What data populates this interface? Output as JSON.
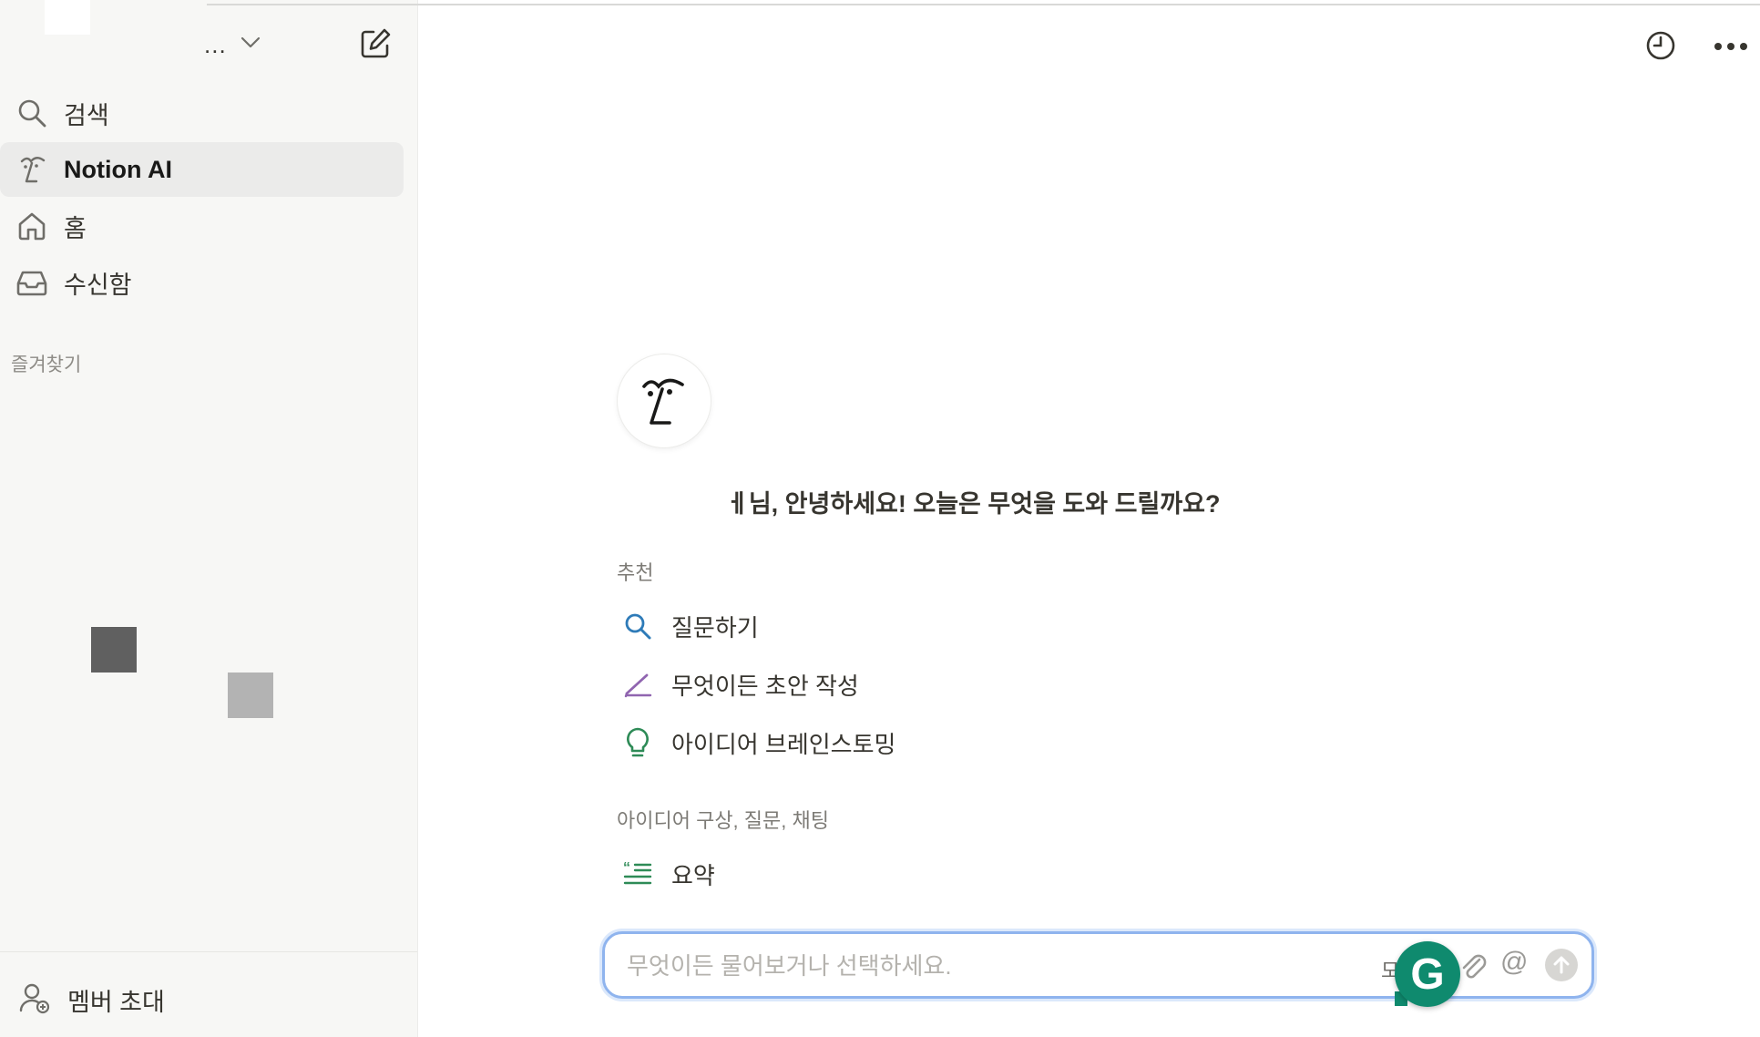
{
  "sidebar": {
    "workspace_name": "...",
    "nav": [
      {
        "label": "검색",
        "icon": "search-icon"
      },
      {
        "label": "Notion AI",
        "icon": "notion-ai-face-icon",
        "active": true
      },
      {
        "label": "홈",
        "icon": "home-icon"
      },
      {
        "label": "수신함",
        "icon": "inbox-icon"
      }
    ],
    "favorites_title": "즐겨찾기",
    "invite_label": "멤버 초대"
  },
  "main": {
    "greeting": "ㅔ님, 안녕하세요! 오늘은 무엇을 도와 드릴까요?",
    "recommended_title": "추천",
    "recommended": [
      {
        "label": "질문하기",
        "icon": "search-icon",
        "color": "#2e7bb8"
      },
      {
        "label": "무엇이든 초안 작성",
        "icon": "pencil-icon",
        "color": "#9065b0"
      },
      {
        "label": "아이디어 브레인스토밍",
        "icon": "lightbulb-icon",
        "color": "#2e8b57"
      }
    ],
    "section2_title": "아이디어 구상, 질문, 채팅",
    "section2": [
      {
        "label": "요약",
        "icon": "quote-lines-icon",
        "color": "#2e8b57"
      }
    ]
  },
  "input": {
    "placeholder": "무엇이든 물어보거나 선택하세요.",
    "mode_text": "모"
  },
  "colors": {
    "sidebar_bg": "#f7f7f5",
    "active_item_bg": "#ebebea",
    "input_border": "#8fb4ee",
    "grammarly": "#0f8a6e"
  }
}
